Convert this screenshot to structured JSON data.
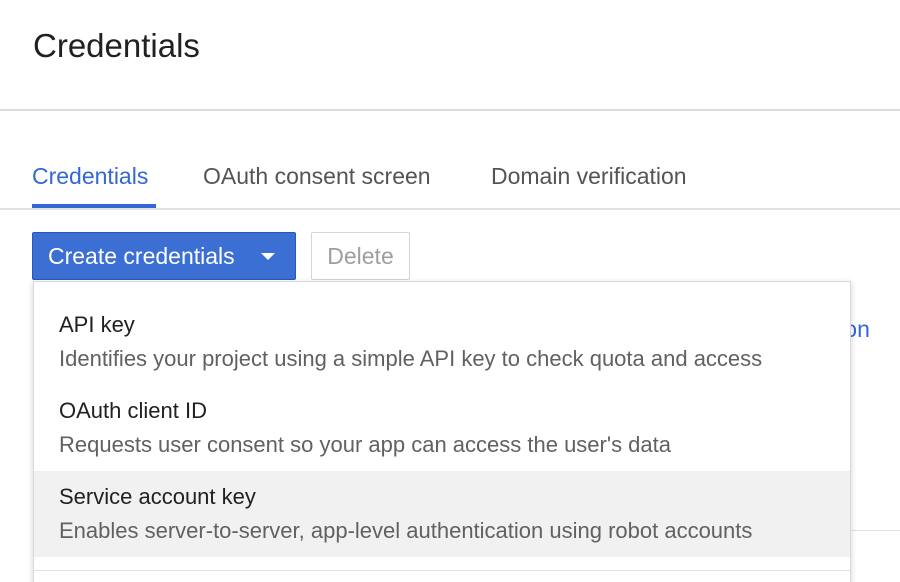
{
  "page": {
    "title": "Credentials"
  },
  "tabs": [
    {
      "label": "Credentials",
      "active": true
    },
    {
      "label": "OAuth consent screen",
      "active": false
    },
    {
      "label": "Domain verification",
      "active": false
    }
  ],
  "toolbar": {
    "create_label": "Create credentials",
    "delete_label": "Delete"
  },
  "background": {
    "partial_link_text": "ation"
  },
  "menu": {
    "items": [
      {
        "title": "API key",
        "description": "Identifies your project using a simple API key to check quota and access"
      },
      {
        "title": "OAuth client ID",
        "description": "Requests user consent so your app can access the user's data"
      },
      {
        "title": "Service account key",
        "description": "Enables server-to-server, app-level authentication using robot accounts",
        "highlighted": true
      }
    ]
  },
  "colors": {
    "accent": "#3367d6",
    "primary_button": "#3b6fd4",
    "hover_background": "#f1f1f1",
    "disabled_text": "#9e9e9e"
  },
  "icons": {
    "dropdown": "caret-down-icon"
  }
}
